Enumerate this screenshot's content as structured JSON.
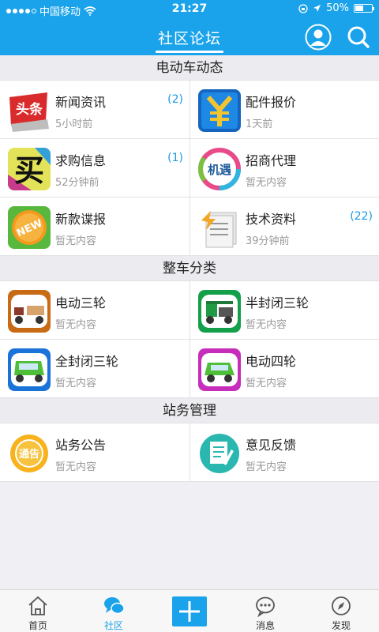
{
  "status_bar": {
    "carrier": "中国移动",
    "time": "21:27",
    "battery": "50%",
    "battery_level": 0.5
  },
  "header": {
    "title": "社区论坛"
  },
  "sections": [
    {
      "title": "电动车动态",
      "items": [
        {
          "title": "新闻资讯",
          "sub": "5小时前",
          "count": "(2)",
          "icon": "headline-news-icon"
        },
        {
          "title": "配件报价",
          "sub": "1天前",
          "count": "",
          "icon": "yuan-price-icon"
        },
        {
          "title": "求购信息",
          "sub": "52分钟前",
          "count": "(1)",
          "icon": "buy-icon"
        },
        {
          "title": "招商代理",
          "sub": "暂无内容",
          "count": "",
          "icon": "opportunity-icon"
        },
        {
          "title": "新款谍报",
          "sub": "暂无内容",
          "count": "",
          "icon": "new-badge-icon"
        },
        {
          "title": "技术资料",
          "sub": "39分钟前",
          "count": "(22)",
          "icon": "documents-icon"
        }
      ]
    },
    {
      "title": "整车分类",
      "items": [
        {
          "title": "电动三轮",
          "sub": "暂无内容",
          "count": "",
          "icon": "tricycle-icon"
        },
        {
          "title": "半封闭三轮",
          "sub": "暂无内容",
          "count": "",
          "icon": "semi-enclosed-tricycle-icon"
        },
        {
          "title": "全封闭三轮",
          "sub": "暂无内容",
          "count": "",
          "icon": "enclosed-tricycle-icon"
        },
        {
          "title": "电动四轮",
          "sub": "暂无内容",
          "count": "",
          "icon": "four-wheeler-icon"
        }
      ]
    },
    {
      "title": "站务管理",
      "items": [
        {
          "title": "站务公告",
          "sub": "暂无内容",
          "count": "",
          "icon": "announcement-icon"
        },
        {
          "title": "意见反馈",
          "sub": "暂无内容",
          "count": "",
          "icon": "feedback-icon"
        }
      ]
    }
  ],
  "icon_text": {
    "news": "头条",
    "buy": "买",
    "opportunity": "机遇",
    "newbadge": "NEW",
    "announce": "通告"
  },
  "tabs": [
    {
      "label": "首页",
      "icon": "home-icon"
    },
    {
      "label": "社区",
      "icon": "chat-bubbles-icon",
      "active": true
    },
    {
      "label": "",
      "icon": "plus-icon"
    },
    {
      "label": "消息",
      "icon": "message-icon"
    },
    {
      "label": "发现",
      "icon": "compass-icon"
    }
  ],
  "colors": {
    "accent": "#1aa3ea",
    "count": "#1b9ae3",
    "muted": "#9a9a9a"
  }
}
